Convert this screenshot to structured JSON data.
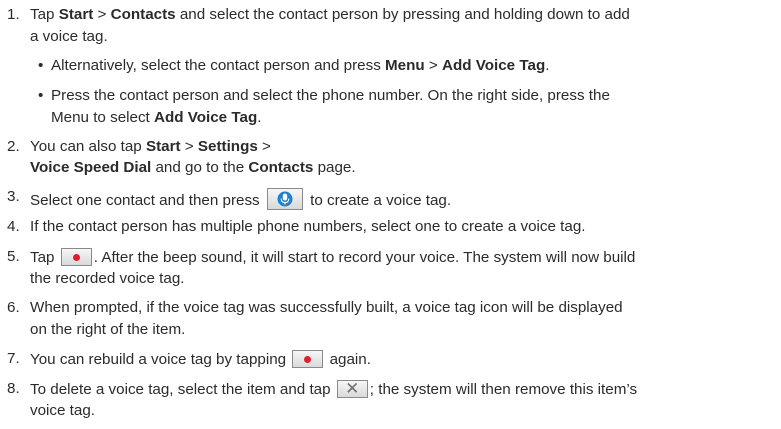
{
  "steps": {
    "s1": {
      "num": "1.",
      "l1a": "Tap ",
      "l1b": "Start",
      "l1c": " > ",
      "l1d": "Contacts",
      "l1e": " and select the contact person by pressing and holding down to add",
      "l2": "a voice tag."
    },
    "b1": {
      "bullet": "•",
      "a": "Alternatively, select the contact person and press ",
      "b": "Menu",
      "c": " > ",
      "d": "Add Voice Tag",
      "e": "."
    },
    "b2": {
      "bullet": "•",
      "l1": "Press the contact person and select the phone number. On the right side, press the",
      "l2a": "Menu to select ",
      "l2b": "Add Voice Tag",
      "l2c": "."
    },
    "s2": {
      "num": "2.",
      "l1a": "You can also tap ",
      "l1b": "Start",
      "l1c": " > ",
      "l1d": "Settings",
      "l1e": " >",
      "l2a": "Voice Speed Dial",
      "l2b": " and go to the ",
      "l2c": "Contacts",
      "l2d": " page."
    },
    "s3": {
      "num": "3.",
      "a": "Select one contact and then press ",
      "b": " to create a voice tag."
    },
    "s4": {
      "num": "4.",
      "a": "If the contact person has multiple phone numbers, select one to create a voice tag."
    },
    "s5": {
      "num": "5.",
      "a": "Tap ",
      "b": ". After the beep sound, it will start to record your voice. The system will now build",
      "l2": "the recorded voice tag."
    },
    "s6": {
      "num": "6.",
      "l1": "When prompted, if the voice tag was successfully built, a voice tag icon will be displayed",
      "l2": "on the right of the item."
    },
    "s7": {
      "num": "7.",
      "a": "You can rebuild a voice tag by tapping ",
      "b": " again."
    },
    "s8": {
      "num": "8.",
      "a": "To delete a voice tag, select the item and tap ",
      "b": "; the system will then remove this item’s",
      "l2": "voice tag."
    }
  },
  "icons": {
    "record": "record-dot-icon",
    "mic": "microphone-icon",
    "delete": "close-x-icon",
    "record_color": "#e41d2b",
    "mic_color": "#1f7fd0"
  }
}
